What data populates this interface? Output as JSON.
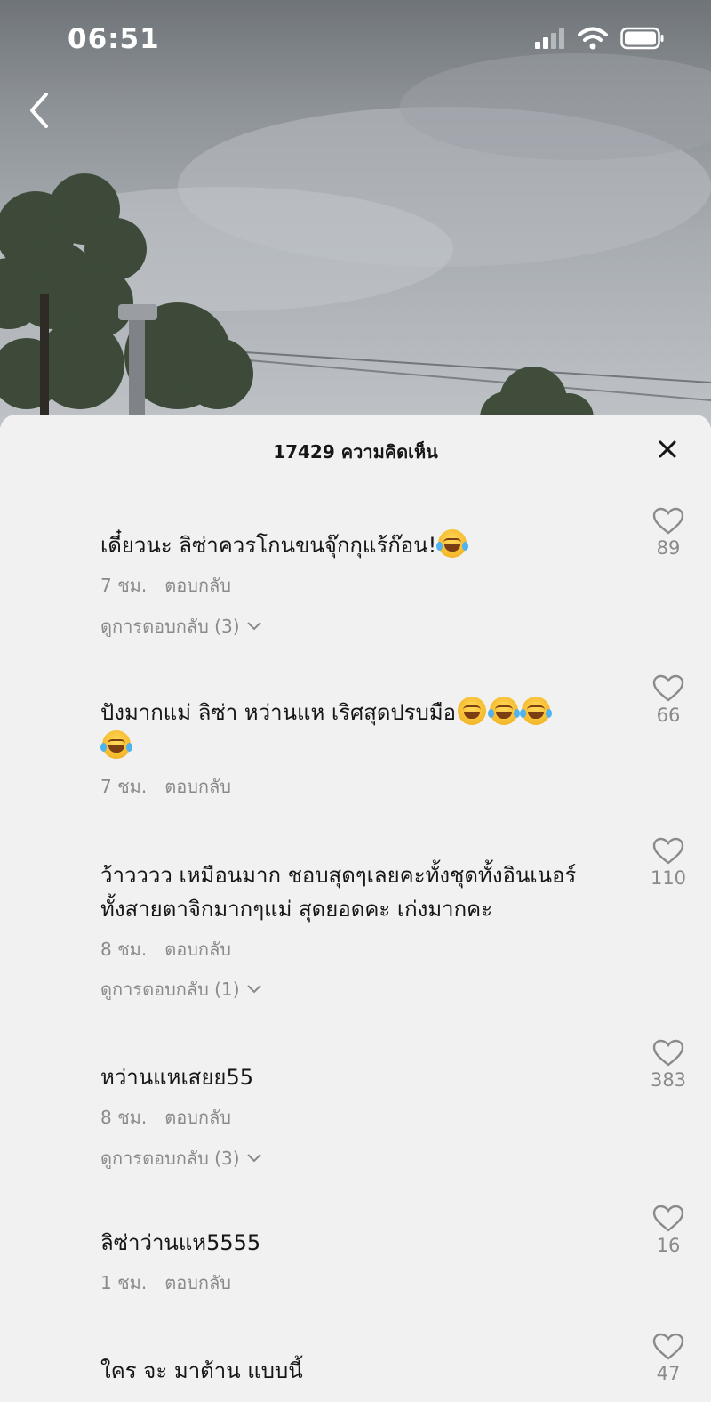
{
  "status_bar": {
    "time": "06:51"
  },
  "sheet": {
    "title": "17429 ความคิดเห็น"
  },
  "comments": [
    {
      "text": "เดี๋ยวนะ ลิซ่าควรโกนขนจุ๊กกุแร้ก๊อน!",
      "emojis": [
        "laugh-tears-emoji"
      ],
      "time": "7 ชม.",
      "reply": "ตอบกลับ",
      "view_replies": "ดูการตอบกลับ (3)",
      "likes": "89"
    },
    {
      "text": "ปังมากแม่ ลิซ่า หว่านแห เริศสุดปรบมือ",
      "emojis": [
        "grin-emoji",
        "laugh-tears-emoji",
        "laugh-tears-emoji",
        "laugh-tears-emoji"
      ],
      "time": "7 ชม.",
      "reply": "ตอบกลับ",
      "view_replies": "",
      "likes": "66"
    },
    {
      "text_line1": "ว้าวววว เหมือนมาก ชอบสุดๆเลยคะทั้งชุดทั้งอินเนอร์",
      "text_line2": "ทั้งสายตาจิกมากๆแม่ สุดยอดคะ เก่งมากคะ",
      "time": "8 ชม.",
      "reply": "ตอบกลับ",
      "view_replies": "ดูการตอบกลับ (1)",
      "likes": "110"
    },
    {
      "text": "หว่านแหเสยย55",
      "time": "8 ชม.",
      "reply": "ตอบกลับ",
      "view_replies": "ดูการตอบกลับ (3)",
      "likes": "383"
    },
    {
      "text": "ลิซ่าว่านแห5555",
      "time": "1 ชม.",
      "reply": "ตอบกลับ",
      "view_replies": "",
      "likes": "16"
    },
    {
      "text": "ใคร จะ มาต้าน แบบนี้",
      "time": "",
      "reply": "",
      "view_replies": "",
      "likes": "47"
    }
  ],
  "icons": {
    "back": "chevron-left-icon",
    "close": "close-icon",
    "like": "heart-icon",
    "expand": "chevron-down-icon",
    "signal": "signal-icon",
    "wifi": "wifi-icon",
    "battery": "battery-icon"
  },
  "colors": {
    "sheet_bg": "#f1f1f1",
    "text": "#161616",
    "meta": "#8a8a8a"
  }
}
